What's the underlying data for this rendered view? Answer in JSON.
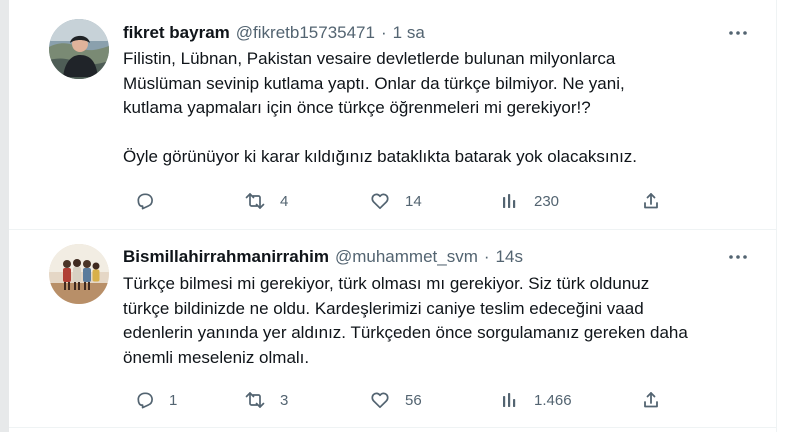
{
  "colors": {
    "text_primary": "#0f1419",
    "text_secondary": "#536471",
    "divider": "#eff3f4",
    "gutter": "#e7e9ea"
  },
  "tweets": [
    {
      "display_name": "fikret bayram",
      "handle": "@fikretb15735471",
      "separator": "·",
      "time": "1 sa",
      "text": "Filistin, Lübnan, Pakistan vesaire devletlerde bulunan milyonlarca\nMüslüman sevinip kutlama yaptı. Onlar da türkçe bilmiyor. Ne yani,\nkutlama yapmaları için önce türkçe öğrenmeleri mi gerekiyor!?\n\nÖyle görünüyor ki karar kıldığınız bataklıkta batarak yok olacaksınız.",
      "actions": {
        "reply": "",
        "retweet": "4",
        "like": "14",
        "views": "230"
      },
      "icons": [
        "more-icon",
        "reply-icon",
        "retweet-icon",
        "like-icon",
        "views-icon",
        "share-icon"
      ]
    },
    {
      "display_name": "Bismillahirrahmanirrahim",
      "handle": "@muhammet_svm",
      "separator": "·",
      "time": "14s",
      "text": "Türkçe bilmesi mi gerekiyor, türk olması mı gerekiyor. Siz türk oldunuz\ntürkçe bildinizde ne oldu. Kardeşlerimizi caniye teslim edeceğini vaad\nedenlerin yanında yer aldınız. Türkçeden önce sorgulamanız gereken daha\nönemli meseleniz olmalı.",
      "actions": {
        "reply": "1",
        "retweet": "3",
        "like": "56",
        "views": "1.466"
      },
      "icons": [
        "more-icon",
        "reply-icon",
        "retweet-icon",
        "like-icon",
        "views-icon",
        "share-icon"
      ]
    }
  ]
}
